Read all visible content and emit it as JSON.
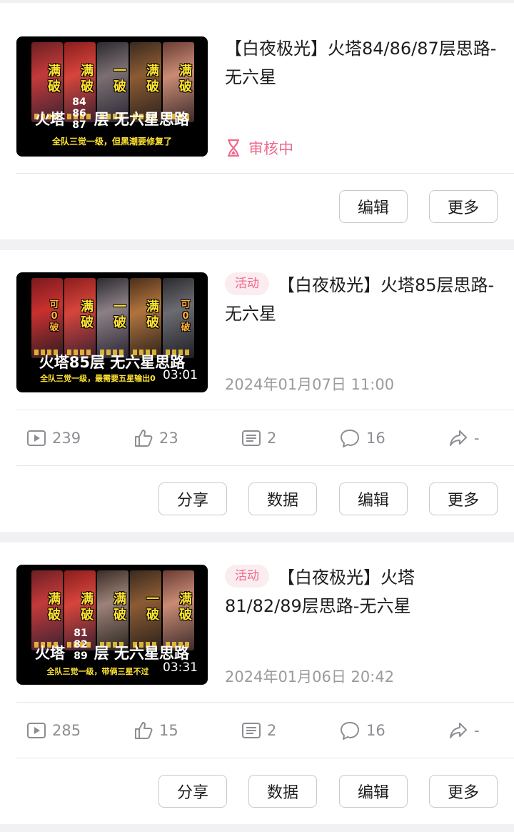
{
  "cards": [
    {
      "thumb": {
        "tags": [
          "满破",
          "满破",
          "一破",
          "满破",
          "满破"
        ],
        "floors": [
          "84",
          "86",
          "87"
        ],
        "headline_prefix": "火塔",
        "headline_suffix": "层 无六星思路",
        "sub": "全队三觉一级，但黑潮要修复了"
      },
      "title": "【白夜极光】火塔84/86/87层思路-无六星",
      "status": "审核中",
      "buttons": [
        "编辑",
        "更多"
      ]
    },
    {
      "thumb": {
        "tags": [
          "可0破",
          "满破",
          "一破",
          "满破",
          "可0破"
        ],
        "headline": "火塔85层 无六星思路",
        "sub": "全队三觉一级，最需要五星输出0",
        "duration": "03:01"
      },
      "badge": "活动",
      "title": "【白夜极光】火塔85层思路-无六星",
      "date": "2024年01月07日 11:00",
      "stats": {
        "plays": "239",
        "likes": "23",
        "comments": "2",
        "danmaku": "16",
        "shares": "-"
      },
      "buttons": [
        "分享",
        "数据",
        "编辑",
        "更多"
      ]
    },
    {
      "thumb": {
        "tags": [
          "满破",
          "满破",
          "满破",
          "一破",
          "满破"
        ],
        "floors": [
          "81",
          "82",
          "89"
        ],
        "headline_prefix": "火塔",
        "headline_suffix": "层 无六星思路",
        "sub": "全队三觉一级，带俩三星不过",
        "duration": "03:31"
      },
      "badge": "活动",
      "title": "【白夜极光】火塔81/82/89层思路-无六星",
      "date": "2024年01月06日 20:42",
      "stats": {
        "plays": "285",
        "likes": "15",
        "comments": "2",
        "danmaku": "16",
        "shares": "-"
      },
      "buttons": [
        "分享",
        "数据",
        "编辑",
        "更多"
      ]
    }
  ],
  "colors": {
    "accent": "#f06a8d",
    "badge_bg": "#fbecef",
    "muted": "#8d8d92",
    "tag_yellow": "#ffe433"
  },
  "icons": [
    "hourglass-icon",
    "play-icon",
    "like-icon",
    "comment-icon",
    "danmaku-icon",
    "share-icon"
  ]
}
